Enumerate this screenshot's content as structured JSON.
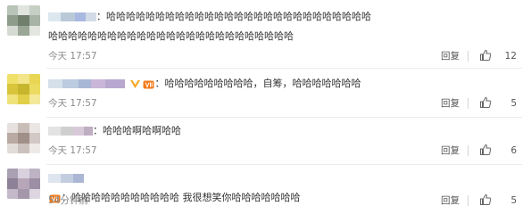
{
  "comments": [
    {
      "text_line1": "：哈哈哈哈哈哈哈哈哈哈哈哈哈哈哈哈哈哈哈哈哈哈哈哈哈哈哈",
      "text_line2": "哈哈哈哈哈哈哈哈哈哈哈哈哈哈哈哈哈哈哈哈哈哈哈哈哈",
      "time": "今天 17:57",
      "reply_label": "回复",
      "like_count": "12"
    },
    {
      "text": "：哈哈哈哈哈哈哈哈哈，自筹，哈哈哈哈哈哈哈",
      "time": "今天 17:57",
      "reply_label": "回复",
      "like_count": "5"
    },
    {
      "text": "：哈哈哈啊哈啊哈哈",
      "time": "今天 17:57",
      "reply_label": "回复",
      "like_count": "6"
    },
    {
      "text": "：哈哈哈哈哈哈哈哈哈哈哈 我很想笑你哈哈哈哈哈哈哈",
      "time": "54分钟前",
      "reply_label": "回复",
      "like_count": "5"
    }
  ],
  "icons": {
    "like": "thumbs-up-icon",
    "vip": "vip-badge-icon",
    "verified": "verified-v-icon"
  },
  "colors": {
    "text": "#333333",
    "meta": "#8a8a8a",
    "divider": "#ebebeb",
    "verified": "#f5a623",
    "vip": "#f27a1a"
  }
}
